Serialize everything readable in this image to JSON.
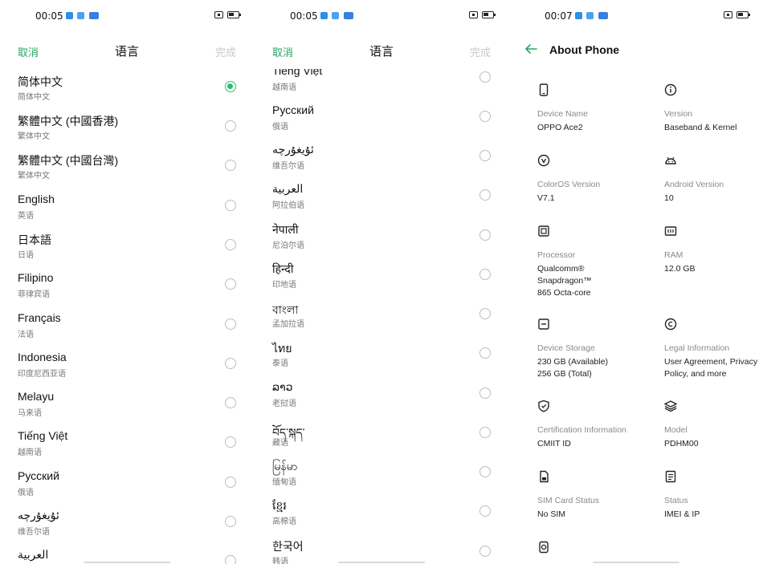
{
  "panel1": {
    "status": {
      "time": "00:05"
    },
    "header": {
      "cancel": "取消",
      "title": "语言",
      "done": "完成"
    },
    "languages": [
      {
        "name": "简体中文",
        "sub": "简体中文",
        "selected": true
      },
      {
        "name": "繁體中文 (中國香港)",
        "sub": "繁体中文"
      },
      {
        "name": "繁體中文 (中國台灣)",
        "sub": "繁体中文"
      },
      {
        "name": "English",
        "sub": "英语"
      },
      {
        "name": "日本語",
        "sub": "日语"
      },
      {
        "name": "Filipino",
        "sub": "菲律宾语"
      },
      {
        "name": "Français",
        "sub": "法语"
      },
      {
        "name": "Indonesia",
        "sub": "印度尼西亚语"
      },
      {
        "name": "Melayu",
        "sub": "马来语"
      },
      {
        "name": "Tiếng Việt",
        "sub": "越南语"
      },
      {
        "name": "Русский",
        "sub": "俄语"
      },
      {
        "name": "ئۇيغۇرچە",
        "sub": "维吾尔语"
      },
      {
        "name": "العربية",
        "sub": ""
      }
    ]
  },
  "panel2": {
    "status": {
      "time": "00:05"
    },
    "header": {
      "cancel": "取消",
      "title": "语言",
      "done": "完成"
    },
    "languages": [
      {
        "name": "Tiếng Việt",
        "sub": "越南语"
      },
      {
        "name": "Русский",
        "sub": "俄语"
      },
      {
        "name": "ئۇيغۇرچە",
        "sub": "维吾尔语"
      },
      {
        "name": "العربية",
        "sub": "阿拉伯语"
      },
      {
        "name": "नेपाली",
        "sub": "尼泊尔语"
      },
      {
        "name": "हिन्दी",
        "sub": "印地语"
      },
      {
        "name": "বাংলা",
        "sub": "孟加拉语"
      },
      {
        "name": "ไทย",
        "sub": "泰语"
      },
      {
        "name": "ລາວ",
        "sub": "老挝语"
      },
      {
        "name": "བོད་སྐད་",
        "sub": "藏语"
      },
      {
        "name": "မြန်မာ",
        "sub": "缅甸语"
      },
      {
        "name": "ខ្មែរ",
        "sub": "高棉语"
      },
      {
        "name": "한국어",
        "sub": "韩语"
      }
    ]
  },
  "panel3": {
    "status": {
      "time": "00:07"
    },
    "header": {
      "title": "About Phone"
    },
    "items": [
      {
        "icon": "phone-icon",
        "label": "Device Name",
        "value": "OPPO Ace2"
      },
      {
        "icon": "info-icon",
        "label": "Version",
        "value": "Baseband & Kernel"
      },
      {
        "icon": "coloros-icon",
        "label": "ColorOS Version",
        "value": "V7.1"
      },
      {
        "icon": "android-icon",
        "label": "Android Version",
        "value": "10"
      },
      {
        "icon": "processor-icon",
        "label": "Processor",
        "value": "Qualcomm® Snapdragon™ 865 Octa-core"
      },
      {
        "icon": "ram-icon",
        "label": "RAM",
        "value": "12.0 GB"
      },
      {
        "icon": "storage-icon",
        "label": "Device Storage",
        "value": "230 GB (Available) 256 GB (Total)"
      },
      {
        "icon": "copyright-icon",
        "label": "Legal Information",
        "value": "User Agreement, Privacy Policy, and more"
      },
      {
        "icon": "shield-icon",
        "label": "Certification Information",
        "value": "CMIIT ID"
      },
      {
        "icon": "layers-icon",
        "label": "Model",
        "value": "PDHM00"
      },
      {
        "icon": "sim-icon",
        "label": "SIM Card Status",
        "value": "No SIM"
      },
      {
        "icon": "document-icon",
        "label": "Status",
        "value": "IMEI & IP"
      },
      {
        "icon": "camera-icon",
        "label": "",
        "value": ""
      }
    ]
  },
  "colors": {
    "accent": "#2aa464",
    "radio_selected": "#2bbf6e",
    "notification_icon": "#2d8fe6"
  }
}
